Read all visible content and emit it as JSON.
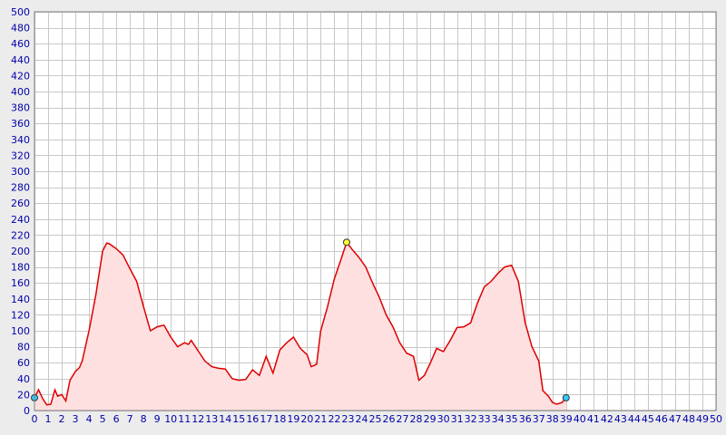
{
  "chart_data": {
    "type": "area",
    "title": "",
    "xlabel": "",
    "ylabel": "",
    "xlim": [
      0,
      50
    ],
    "ylim": [
      0,
      500
    ],
    "x_ticks": [
      0,
      1,
      2,
      3,
      4,
      5,
      6,
      7,
      8,
      9,
      10,
      11,
      12,
      13,
      14,
      15,
      16,
      17,
      18,
      19,
      20,
      21,
      22,
      23,
      24,
      25,
      26,
      27,
      28,
      29,
      30,
      31,
      32,
      33,
      34,
      35,
      36,
      37,
      38,
      39,
      40,
      41,
      42,
      43,
      44,
      45,
      46,
      47,
      48,
      49,
      50
    ],
    "y_ticks": [
      0,
      20,
      40,
      60,
      80,
      100,
      120,
      140,
      160,
      180,
      200,
      220,
      240,
      260,
      280,
      300,
      320,
      340,
      360,
      380,
      400,
      420,
      440,
      460,
      480,
      500
    ],
    "grid": true,
    "colors": {
      "line": "#dd0000",
      "fill": "#ffe0e0",
      "grid": "#c8c8c8",
      "ticks": "#0000aa",
      "marker_end": "#33ccff",
      "marker_peak": "#ffff33"
    },
    "series": [
      {
        "x": [
          0,
          0.3,
          0.6,
          0.9,
          1.2,
          1.5,
          1.7,
          2.0,
          2.3,
          2.6,
          3.0,
          3.3,
          3.5,
          4.0,
          4.5,
          5.0,
          5.3,
          5.5,
          6.0,
          6.5,
          7.0,
          7.5,
          8.0,
          8.5,
          9.0,
          9.5,
          10.0,
          10.5,
          11.0,
          11.3,
          11.5,
          12.0,
          12.5,
          13.0,
          13.5,
          14.0,
          14.5,
          15.0,
          15.5,
          16.0,
          16.5,
          17.0,
          17.5,
          18.0,
          18.5,
          19.0,
          19.5,
          20.0,
          20.3,
          20.7,
          21.0,
          21.5,
          22.0,
          22.5,
          22.9,
          23.3,
          23.8,
          24.3,
          24.8,
          25.3,
          25.8,
          26.3,
          26.8,
          27.3,
          27.8,
          28.2,
          28.6,
          29.0,
          29.5,
          30.0,
          30.5,
          31.0,
          31.5,
          32.0,
          32.5,
          33.0,
          33.5,
          34.0,
          34.5,
          35.0,
          35.5,
          36.0,
          36.5,
          37.0,
          37.3,
          37.7,
          38.0,
          38.3,
          38.7,
          39.0
        ],
        "y": [
          16,
          26,
          15,
          7,
          8,
          26,
          18,
          20,
          12,
          38,
          49,
          54,
          62,
          100,
          145,
          200,
          210,
          209,
          203,
          195,
          178,
          162,
          130,
          100,
          105,
          107,
          92,
          80,
          85,
          83,
          88,
          75,
          62,
          55,
          53,
          52,
          40,
          38,
          39,
          51,
          44,
          68,
          47,
          76,
          85,
          92,
          78,
          70,
          55,
          58,
          100,
          130,
          165,
          190,
          211,
          202,
          192,
          180,
          160,
          142,
          120,
          105,
          85,
          72,
          68,
          38,
          44,
          58,
          78,
          74,
          88,
          104,
          105,
          110,
          135,
          155,
          162,
          172,
          180,
          182,
          162,
          110,
          80,
          62,
          25,
          18,
          10,
          8,
          10,
          16
        ]
      }
    ],
    "markers": [
      {
        "x": 0,
        "y": 16,
        "color": "#33ccff"
      },
      {
        "x": 22.9,
        "y": 211,
        "color": "#ffff33"
      },
      {
        "x": 39.0,
        "y": 16,
        "color": "#33ccff"
      }
    ]
  }
}
